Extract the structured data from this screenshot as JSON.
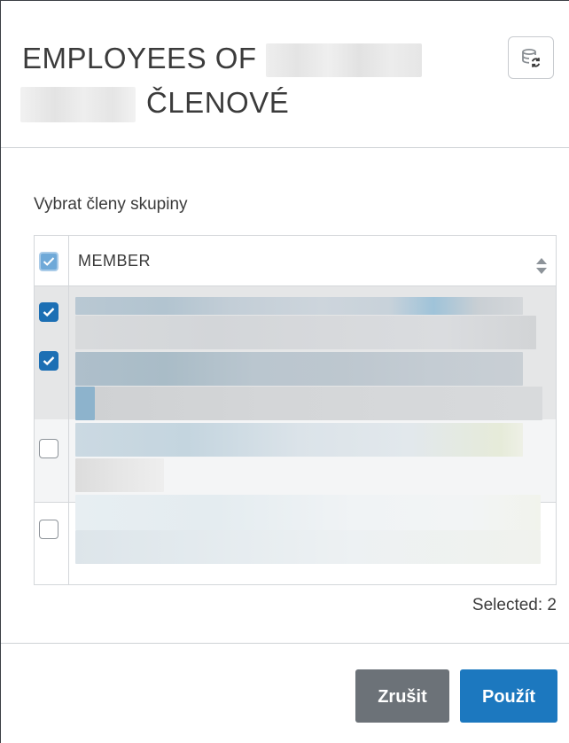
{
  "dialog": {
    "title_prefix": "EMPLOYEES OF",
    "title_suffix": "ČLENOVÉ",
    "refresh_icon": "database-refresh-icon"
  },
  "members": {
    "label": "Vybrat členy skupiny",
    "column_header": "MEMBER",
    "rows": [
      {
        "checked": true
      },
      {
        "checked": true
      },
      {
        "checked": false
      },
      {
        "checked": false
      }
    ],
    "selected_text": "Selected: 2"
  },
  "footer": {
    "cancel_label": "Zrušit",
    "apply_label": "Použít"
  },
  "colors": {
    "primary": "#1c78bf",
    "secondary": "#6c7278",
    "checkbox_checked": "#1c6fb4"
  }
}
